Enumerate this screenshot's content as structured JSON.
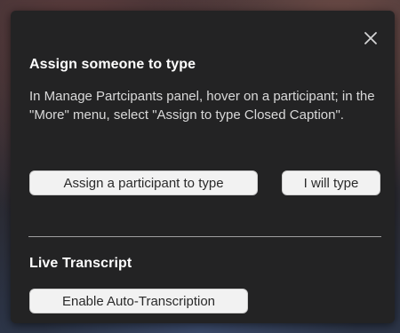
{
  "dialog": {
    "close_icon": "close-icon",
    "assign_section": {
      "title": "Assign someone to type",
      "description": "In Manage Partcipants panel, hover on a participant; in the \"More\" menu, select \"Assign to type Closed Caption\".",
      "assign_button_label": "Assign a participant to type",
      "self_button_label": "I will type"
    },
    "transcript_section": {
      "title": "Live Transcript",
      "enable_button_label": "Enable Auto-Transcription"
    }
  },
  "colors": {
    "panel_background": "#232324",
    "text_primary": "#ffffff",
    "text_secondary": "#d9d9d9",
    "button_background": "#f2f2f2"
  }
}
